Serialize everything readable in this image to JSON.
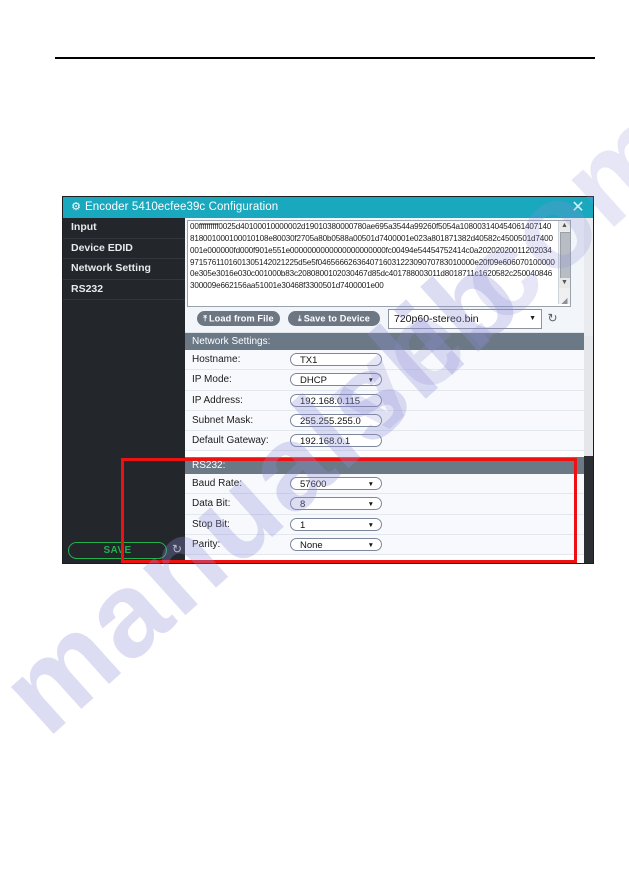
{
  "dialog": {
    "title": "Encoder 5410ecfee39c Configuration",
    "gear_icon": "gear-icon",
    "close_icon": "✕"
  },
  "sidebar": {
    "items": [
      {
        "label": "Input"
      },
      {
        "label": "Device EDID"
      },
      {
        "label": "Network Setting"
      },
      {
        "label": "RS232"
      }
    ],
    "save_label": "SAVE",
    "refresh_icon": "↻"
  },
  "edid": {
    "hex": "00ffffffffff0025d40100010000002d19010380000780ae695a3544a99260f5054a108003140454061407140818001000100010108e80030f2705a80b0588a00501d7400001e023a801871382d40582c4500501d7400001e000000fd000f901e551e0000000000000000000000fc00494e54454752414c0a202020200112020349715761101601305142021225d5e5f046566626364071603122309070783010000e20f09e6060701000000e305e3016e030c001000b83c2080800102030467d85dc401788003011d8018711c1620582c250040846300009e662156aa51001e30468f3300501d7400001e00",
    "load_button": "Load from File",
    "save_button": "Save to Device",
    "load_icon": "⤒",
    "save_icon": "⤓",
    "file_selected": "720p60-stereo.bin",
    "dropdown_arrow": "▼",
    "refresh_icon": "↻",
    "scroll_up_icon": "▲",
    "scroll_down_icon": "▼",
    "resize_icon": "◢"
  },
  "network": {
    "heading": "Network Settings:",
    "rows": [
      {
        "label": "Hostname:",
        "value": "TX1",
        "type": "text"
      },
      {
        "label": "IP Mode:",
        "value": "DHCP",
        "type": "select"
      },
      {
        "label": "IP Address:",
        "value": "192.168.0.115",
        "type": "text"
      },
      {
        "label": "Subnet Mask:",
        "value": "255.255.255.0",
        "type": "text"
      },
      {
        "label": "Default Gateway:",
        "value": "192.168.0.1",
        "type": "text"
      }
    ]
  },
  "rs232": {
    "heading": "RS232:",
    "rows": [
      {
        "label": "Baud Rate:",
        "value": "57600",
        "type": "select"
      },
      {
        "label": "Data Bit:",
        "value": "8",
        "type": "select"
      },
      {
        "label": "Stop Bit:",
        "value": "1",
        "type": "select"
      },
      {
        "label": "Parity:",
        "value": "None",
        "type": "select"
      }
    ],
    "highlight_color": "#ee1111"
  },
  "watermark": {
    "text_a": "manualslib",
    "text_b": "ve.com"
  },
  "colors": {
    "titlebar": "#1aa8be",
    "sidebar": "#23262b",
    "section_header": "#6b7886",
    "save_green": "#22b14c",
    "highlight_red": "#ee1111"
  }
}
